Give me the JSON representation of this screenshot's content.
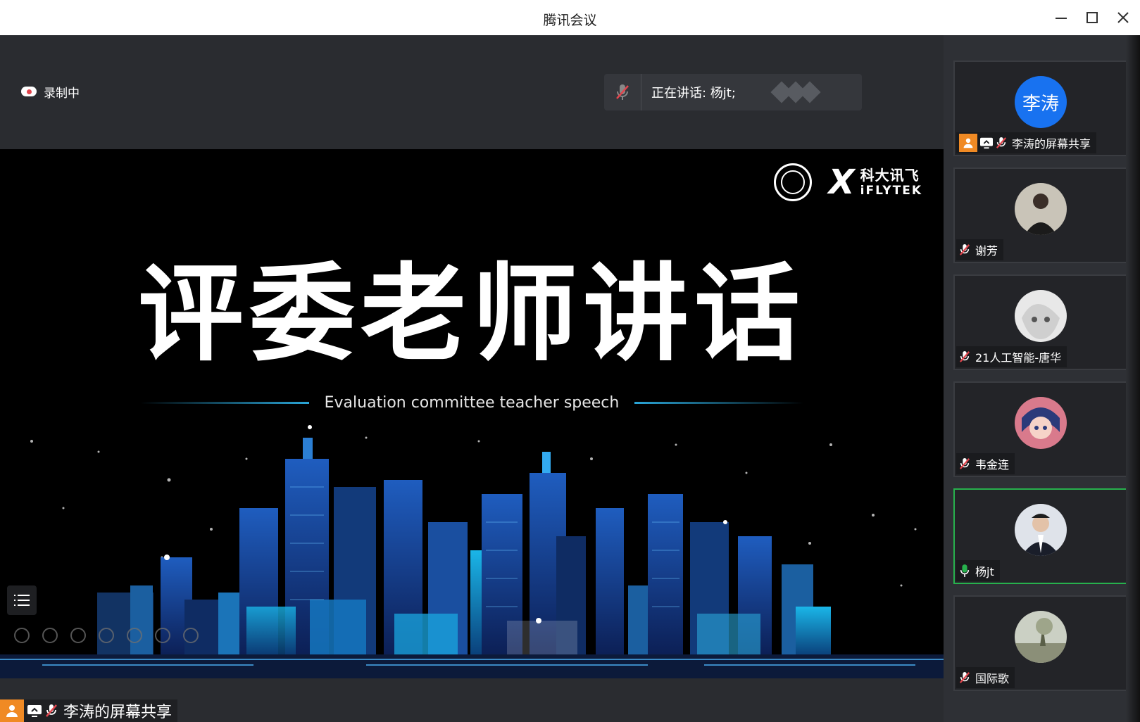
{
  "window": {
    "title": "腾讯会议"
  },
  "recording": {
    "label": "录制中"
  },
  "speaking": {
    "label": "正在讲话: 杨jt;"
  },
  "slide": {
    "title": "评委老师讲话",
    "subtitle": "Evaluation committee teacher speech",
    "logo_cn": "科大讯飞",
    "logo_en": "iFLYTEK"
  },
  "share_tag": {
    "label": "李涛的屏幕共享"
  },
  "participants": [
    {
      "name": "李涛的屏幕共享",
      "avatar_text": "李涛",
      "mic": "muted",
      "sharing": true
    },
    {
      "name": "谢芳",
      "mic": "muted"
    },
    {
      "name": "21人工智能-唐华",
      "mic": "muted"
    },
    {
      "name": "韦金连",
      "mic": "muted"
    },
    {
      "name": "杨jt",
      "mic": "active"
    },
    {
      "name": "国际歌",
      "mic": "muted"
    }
  ],
  "colors": {
    "accent_blue": "#1872f0",
    "active_green": "#27b14d",
    "share_orange": "#f08a24",
    "muted_red": "#e2454d"
  }
}
